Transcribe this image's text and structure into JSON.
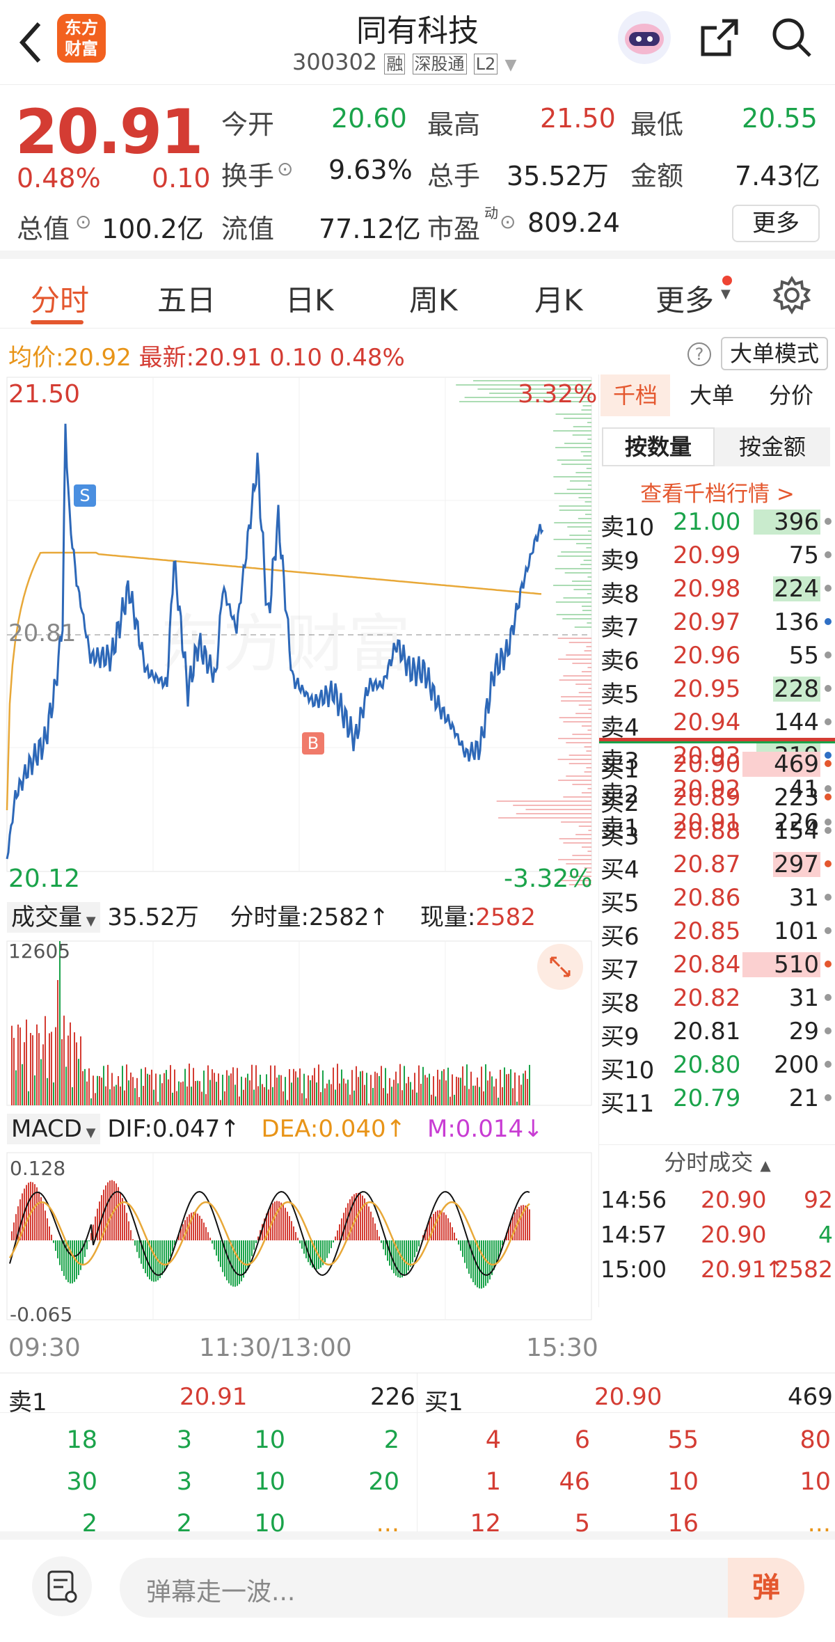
{
  "header": {
    "title": "同有科技",
    "code": "300302",
    "tags": [
      "融",
      "深股通",
      "L2"
    ]
  },
  "quote": {
    "price": "20.91",
    "pct": "0.48%",
    "change": "0.10",
    "open_label": "今开",
    "open": "20.60",
    "high_label": "最高",
    "high": "21.50",
    "low_label": "最低",
    "low": "20.55",
    "turnover_label": "换手",
    "turnover": "9.63%",
    "vol_label": "总手",
    "vol": "35.52万",
    "amount_label": "金额",
    "amount": "7.43亿",
    "mcap_label": "总值",
    "mcap": "100.2亿",
    "float_label": "流值",
    "float": "77.12亿",
    "pe_label": "市盈",
    "pe_sup": "动",
    "pe": "809.24",
    "more": "更多"
  },
  "tabs": [
    "分时",
    "五日",
    "日K",
    "周K",
    "月K",
    "更多"
  ],
  "info": {
    "avg_label": "均价:",
    "avg": "20.92",
    "last_label": "最新:",
    "last": "20.91",
    "chg": "0.10",
    "pct": "0.48%",
    "mode": "大单模式"
  },
  "chart": {
    "ymax": "21.50",
    "ymin": "20.12",
    "pmax": "3.32%",
    "pmin": "-3.32%",
    "mid": "20.81",
    "s_marker": "S",
    "b_marker": "B",
    "watermark": "东方财富",
    "vol_title": "成交量",
    "vol_total": "35.52万",
    "vol_fs_label": "分时量:",
    "vol_fs": "2582",
    "vol_now_label": "现量:",
    "vol_now": "2582",
    "vol_max": "12605",
    "macd_title": "MACD",
    "dif": "DIF:0.047",
    "dea": "DEA:0.040",
    "m": "M:0.014",
    "macd_max": "0.128",
    "macd_min": "-0.065",
    "t_start": "09:30",
    "t_mid": "11:30/13:00",
    "t_end": "15:30"
  },
  "orderbook": {
    "tabs": [
      "千档",
      "大单",
      "分价"
    ],
    "subtabs": [
      "按数量",
      "按金额"
    ],
    "link": "查看千档行情 >",
    "asks": [
      {
        "l": "卖10",
        "p": "21.00",
        "v": "396"
      },
      {
        "l": "卖9",
        "p": "20.99",
        "v": "75"
      },
      {
        "l": "卖8",
        "p": "20.98",
        "v": "224"
      },
      {
        "l": "卖7",
        "p": "20.97",
        "v": "136"
      },
      {
        "l": "卖6",
        "p": "20.96",
        "v": "55"
      },
      {
        "l": "卖5",
        "p": "20.95",
        "v": "228"
      },
      {
        "l": "卖4",
        "p": "20.94",
        "v": "144"
      },
      {
        "l": "卖3",
        "p": "20.93",
        "v": "319"
      },
      {
        "l": "卖2",
        "p": "20.92",
        "v": "41"
      },
      {
        "l": "卖1",
        "p": "20.91",
        "v": "226"
      }
    ],
    "bids": [
      {
        "l": "买1",
        "p": "20.90",
        "v": "469"
      },
      {
        "l": "买2",
        "p": "20.89",
        "v": "223"
      },
      {
        "l": "买3",
        "p": "20.88",
        "v": "154"
      },
      {
        "l": "买4",
        "p": "20.87",
        "v": "297"
      },
      {
        "l": "买5",
        "p": "20.86",
        "v": "31"
      },
      {
        "l": "买6",
        "p": "20.85",
        "v": "101"
      },
      {
        "l": "买7",
        "p": "20.84",
        "v": "510"
      },
      {
        "l": "买8",
        "p": "20.82",
        "v": "31"
      },
      {
        "l": "买9",
        "p": "20.81",
        "v": "29"
      },
      {
        "l": "买10",
        "p": "20.80",
        "v": "200"
      },
      {
        "l": "买11",
        "p": "20.79",
        "v": "21"
      }
    ],
    "deals_title": "分时成交",
    "deals": [
      {
        "t": "14:56",
        "p": "20.90",
        "v": "92"
      },
      {
        "t": "14:57",
        "p": "20.90",
        "v": "4"
      },
      {
        "t": "15:00",
        "p": "20.91",
        "v": "2582"
      }
    ]
  },
  "trades": {
    "sell_label": "卖1",
    "sell_price": "20.91",
    "sell_total": "226",
    "buy_label": "买1",
    "buy_price": "20.90",
    "buy_total": "469",
    "sell_rows": [
      [
        "18",
        "3",
        "10",
        "2"
      ],
      [
        "30",
        "3",
        "10",
        "20"
      ],
      [
        "2",
        "2",
        "10",
        "..."
      ]
    ],
    "buy_rows": [
      [
        "4",
        "6",
        "55",
        "80"
      ],
      [
        "1",
        "46",
        "10",
        "10"
      ],
      [
        "12",
        "5",
        "16",
        "..."
      ]
    ]
  },
  "bottom": {
    "placeholder": "弹幕走一波...",
    "danmu": "弹"
  }
}
